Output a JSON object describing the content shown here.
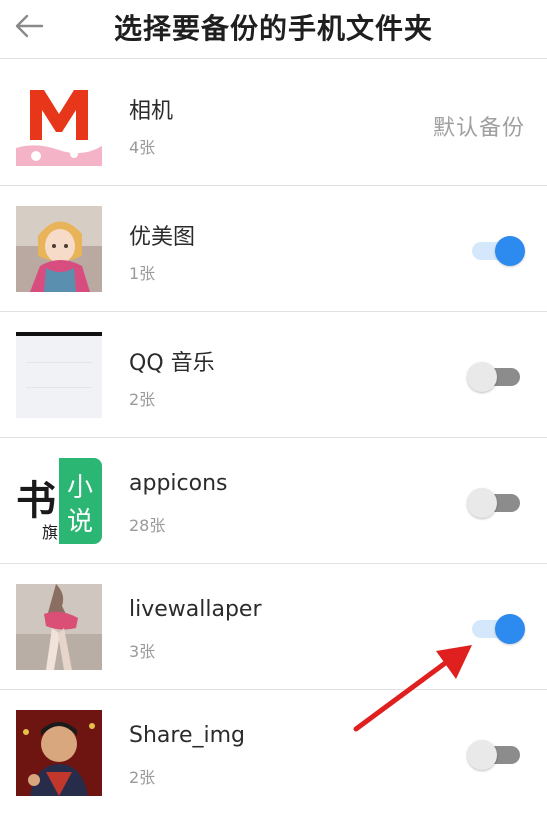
{
  "header": {
    "title": "选择要备份的手机文件夹"
  },
  "default_backup_label": "默认备份",
  "folders": [
    {
      "name": "相机",
      "count": "4张",
      "thumb": "m-logo",
      "state": "default"
    },
    {
      "name": "优美图",
      "count": "1张",
      "thumb": "anime-girl",
      "state": "on"
    },
    {
      "name": "QQ 音乐",
      "count": "2张",
      "thumb": "blank-screen",
      "state": "off"
    },
    {
      "name": "appicons",
      "count": "28张",
      "thumb": "book-app-icon",
      "state": "off"
    },
    {
      "name": "livewallaper",
      "count": "3张",
      "thumb": "wallpaper-figure",
      "state": "on"
    },
    {
      "name": "Share_img",
      "count": "2张",
      "thumb": "portrait-painting",
      "state": "off"
    }
  ],
  "thumb_text": {
    "book_icon_left": "书",
    "book_icon_small": "旗",
    "book_icon_right_top": "小",
    "book_icon_right_bottom": "说"
  },
  "colors": {
    "toggle_on": "#2d8bf0",
    "toggle_on_track": "#d5e7fb",
    "toggle_off_track": "#8c8c8c",
    "annotation_arrow": "#e0201f"
  }
}
